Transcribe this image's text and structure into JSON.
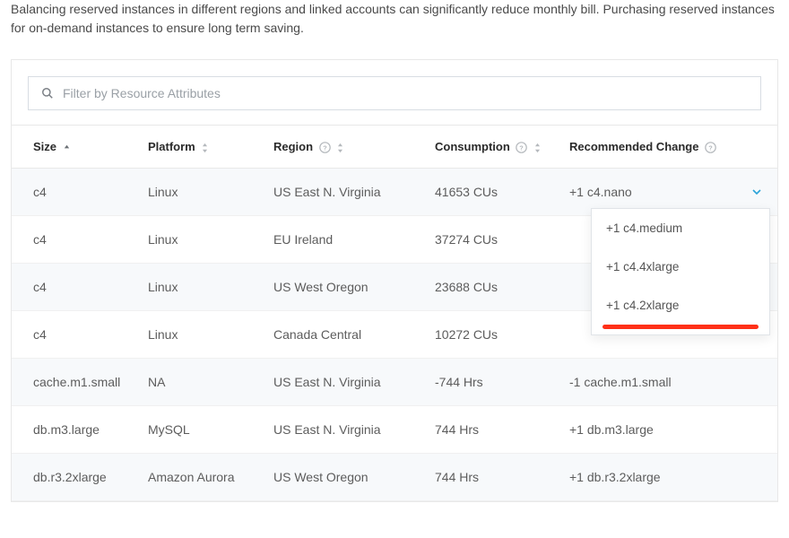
{
  "description": "Balancing reserved instances in different regions and linked accounts can significantly reduce monthly bill. Purchasing reserved instances for on-demand instances to ensure long term saving.",
  "filter": {
    "placeholder": "Filter by Resource Attributes"
  },
  "columns": {
    "size": "Size",
    "platform": "Platform",
    "region": "Region",
    "consumption": "Consumption",
    "recommended": "Recommended Change"
  },
  "rows": [
    {
      "size": "c4",
      "platform": "Linux",
      "region": "US East N. Virginia",
      "consumption": "41653 CUs",
      "recommended": "+1 c4.nano"
    },
    {
      "size": "c4",
      "platform": "Linux",
      "region": "EU Ireland",
      "consumption": "37274 CUs",
      "recommended": ""
    },
    {
      "size": "c4",
      "platform": "Linux",
      "region": "US West Oregon",
      "consumption": "23688 CUs",
      "recommended": ""
    },
    {
      "size": "c4",
      "platform": "Linux",
      "region": "Canada Central",
      "consumption": "10272 CUs",
      "recommended": ""
    },
    {
      "size": "cache.m1.small",
      "platform": "NA",
      "region": "US East N. Virginia",
      "consumption": "-744 Hrs",
      "recommended": "-1 cache.m1.small"
    },
    {
      "size": "db.m3.large",
      "platform": "MySQL",
      "region": "US East N. Virginia",
      "consumption": "744 Hrs",
      "recommended": "+1 db.m3.large"
    },
    {
      "size": "db.r3.2xlarge",
      "platform": "Amazon Aurora",
      "region": "US West Oregon",
      "consumption": "744 Hrs",
      "recommended": "+1 db.r3.2xlarge"
    }
  ],
  "dropdown": {
    "items": [
      "+1 c4.medium",
      "+1 c4.4xlarge",
      "+1 c4.2xlarge"
    ]
  }
}
